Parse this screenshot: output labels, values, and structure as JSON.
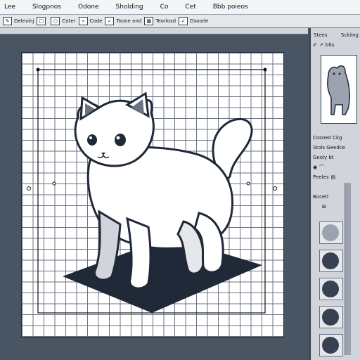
{
  "menu": [
    "Lee",
    "Slogpnos",
    "Odone",
    "Sholding",
    "Co",
    "Cet",
    "Bbb poieos"
  ],
  "toolbar": {
    "items": [
      {
        "label": "Delevinj",
        "icon": "pen-icon"
      },
      {
        "label": "",
        "icon": "square-icon"
      },
      {
        "label": "Coter",
        "icon": "circle-icon"
      },
      {
        "label": "Code",
        "icon": "brush-icon"
      },
      {
        "label": "Toone ond",
        "icon": "checkbox-icon"
      },
      {
        "label": "Teorlosd",
        "icon": "grid-icon"
      },
      {
        "label": "Dsoode",
        "icon": "checkbox-icon"
      }
    ]
  },
  "panel": {
    "title": "Stees",
    "subtitle": "Sckiing",
    "sub2": "blts",
    "row1": "Cosoed Ckg",
    "row2": "Stols  Geedce",
    "row3": "Geoly  bt",
    "row4": "Peeles",
    "swatches_title": "Bocetl",
    "swatch_colors": [
      "#9ca3af",
      "#374151",
      "#374151",
      "#374151",
      "#374151"
    ]
  }
}
